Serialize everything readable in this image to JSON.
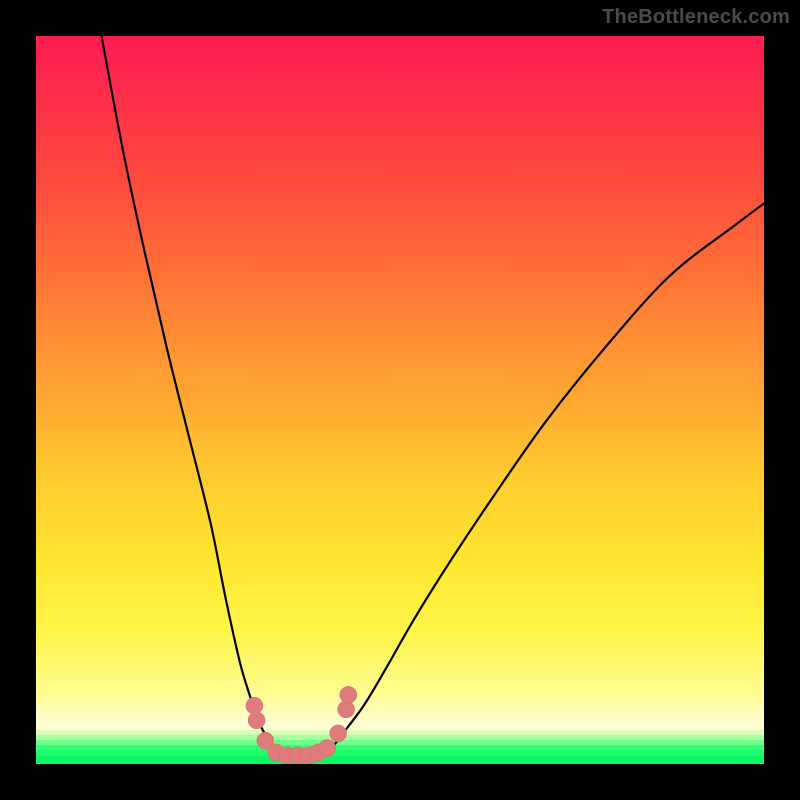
{
  "watermark": "TheBottleneck.com",
  "colors": {
    "background": "#000000",
    "gradient_top": "#ff1a52",
    "gradient_mid": "#ffe62f",
    "gradient_bottom": "#0cf765",
    "curve": "#000000",
    "marker": "#e07b7b"
  },
  "chart_data": {
    "type": "line",
    "title": "",
    "xlabel": "",
    "ylabel": "",
    "xlim": [
      0,
      100
    ],
    "ylim": [
      0,
      100
    ],
    "series": [
      {
        "name": "left-branch",
        "x": [
          9,
          12,
          15,
          18,
          21,
          24,
          26,
          28,
          29.5,
          30.5,
          31.5,
          32.5
        ],
        "y": [
          100,
          84,
          70,
          57,
          45,
          33,
          23,
          14,
          9,
          6,
          4,
          2
        ]
      },
      {
        "name": "bottom-flat",
        "x": [
          32.5,
          33.5,
          34.5,
          35.5,
          36.5,
          37.5,
          38.5,
          39.5,
          40.5
        ],
        "y": [
          2,
          1.2,
          1,
          1,
          1,
          1,
          1.2,
          1.6,
          2
        ]
      },
      {
        "name": "right-branch",
        "x": [
          40.5,
          42,
          45,
          48,
          52,
          57,
          63,
          70,
          78,
          87,
          96,
          100
        ],
        "y": [
          2,
          4,
          8,
          13,
          20,
          28,
          37,
          47,
          57,
          67,
          74,
          77
        ]
      }
    ],
    "markers": {
      "name": "bottom-cluster",
      "points": [
        {
          "x": 30.0,
          "y": 8.0
        },
        {
          "x": 30.3,
          "y": 6.0
        },
        {
          "x": 31.5,
          "y": 3.2
        },
        {
          "x": 33.0,
          "y": 1.6
        },
        {
          "x": 34.5,
          "y": 1.2
        },
        {
          "x": 36.0,
          "y": 1.2
        },
        {
          "x": 37.5,
          "y": 1.2
        },
        {
          "x": 38.8,
          "y": 1.6
        },
        {
          "x": 40.0,
          "y": 2.2
        },
        {
          "x": 41.5,
          "y": 4.2
        },
        {
          "x": 42.6,
          "y": 7.5
        },
        {
          "x": 42.9,
          "y": 9.5
        }
      ]
    }
  }
}
